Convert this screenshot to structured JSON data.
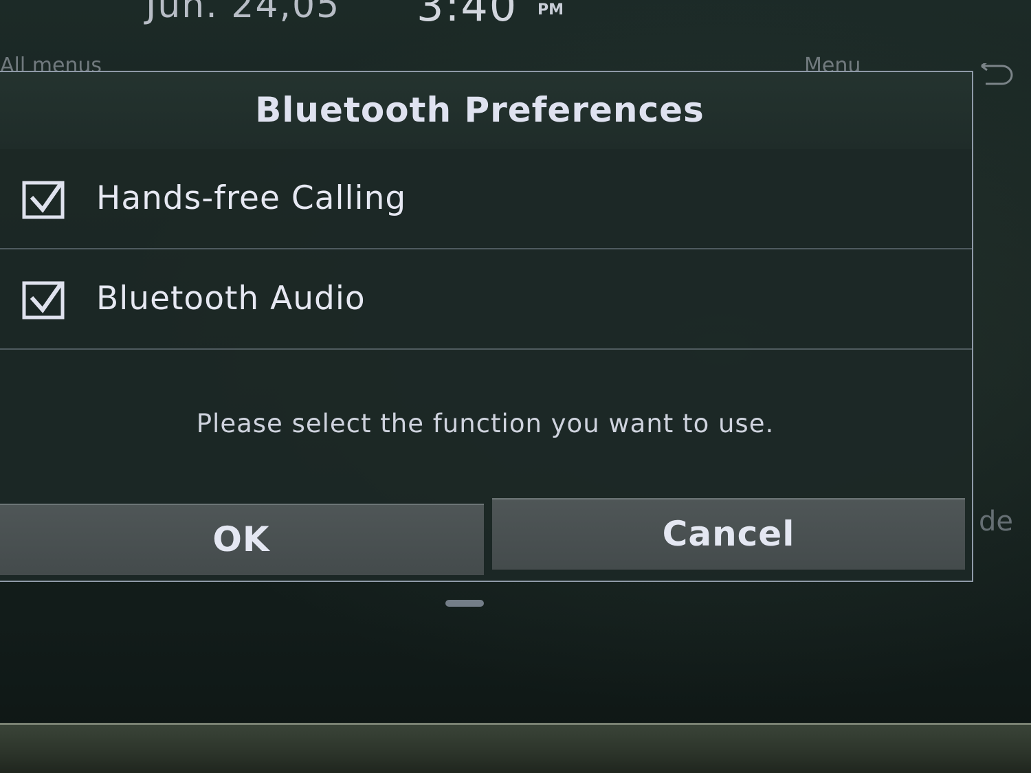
{
  "status_bar": {
    "date": "Jun. 24,05",
    "time": "3:40",
    "ampm": "PM"
  },
  "background": {
    "menu_left": "All menus",
    "menu_right": "Menu",
    "right_label": "de"
  },
  "dialog": {
    "title": "Bluetooth Preferences",
    "options": [
      {
        "label": "Hands-free Calling",
        "checked": true
      },
      {
        "label": "Bluetooth Audio",
        "checked": true
      }
    ],
    "message": "Please select the function you want to use.",
    "ok_label": "OK",
    "cancel_label": "Cancel"
  },
  "colors": {
    "dialog_border": "#8f9aa8",
    "dialog_bg": "#1c2826",
    "button_bg": "#4c5354",
    "text": "#e4e7f2"
  },
  "icons": {
    "checkbox": "checkbox-checked-icon",
    "back": "back-arrow-icon"
  }
}
